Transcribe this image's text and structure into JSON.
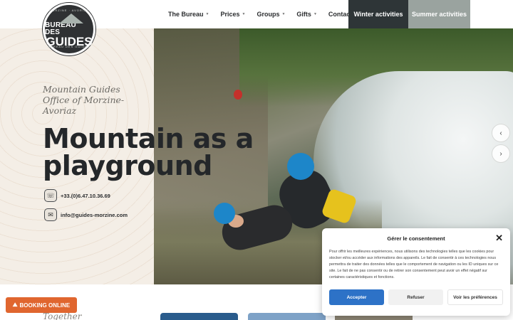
{
  "header": {
    "logo": {
      "top_text": "MORZINE · AVORIAZ",
      "line1": "BUREAU DES",
      "line2": "GUIDES",
      "bottom_text": "BUREAU DES GUIDES"
    },
    "nav": [
      {
        "label": "The Bureau"
      },
      {
        "label": "Prices"
      },
      {
        "label": "Groups"
      },
      {
        "label": "Gifts"
      },
      {
        "label": "Contact"
      }
    ],
    "winter_label": "Winter activities",
    "summer_label": "Summer activities",
    "colors": {
      "winter_bg": "#2e3537",
      "summer_bg": "#9aa39f"
    }
  },
  "hero": {
    "tagline": "Mountain Guides Office of Morzine-Avoriaz",
    "headline_line1": "Mountain as a",
    "headline_line2": "playground",
    "phone": "+33.(0)6.47.10.36.69",
    "email": "info@guides-morzine.com",
    "prev_icon": "‹",
    "next_icon": "›"
  },
  "bottom": {
    "together_text": "Together",
    "booking_label": "BOOKING ONLINE",
    "booking_color": "#e0662f"
  },
  "consent": {
    "title": "Gérer le consentement",
    "body": "Pour offrir les meilleures expériences, nous utilisons des technologies telles que les cookies pour stocker et/ou accéder aux informations des appareils. Le fait de consentir à ces technologies nous permettra de traiter des données telles que le comportement de navigation ou les ID uniques sur ce site. Le fait de ne pas consentir ou de retirer son consentement peut avoir un effet négatif sur certaines caractéristiques et fonctions.",
    "accept_label": "Accepter",
    "refuse_label": "Refuser",
    "prefs_label": "Voir les préférences",
    "accent": "#2d72c7"
  }
}
